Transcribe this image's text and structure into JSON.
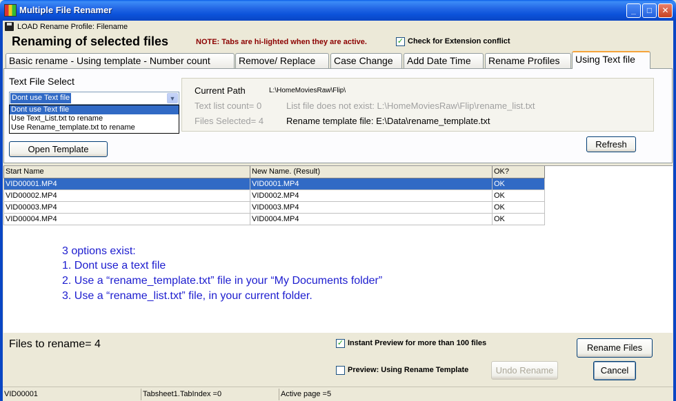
{
  "window": {
    "title": "Multiple File Renamer"
  },
  "profile_label": "LOAD Rename Profile: Filename",
  "heading": "Renaming of selected files",
  "note": "NOTE: Tabs are hi-lighted when they are active.",
  "check_ext_label": "Check for Extension conflict",
  "tabs": [
    {
      "label": "Basic rename - Using template - Number count"
    },
    {
      "label": "Remove/ Replace"
    },
    {
      "label": "Case Change"
    },
    {
      "label": "Add Date Time"
    },
    {
      "label": "Rename Profiles"
    },
    {
      "label": "Using Text file"
    }
  ],
  "text_file_select": {
    "label": "Text File Select",
    "selected": "Dont use Text file",
    "options": [
      "Dont use Text file",
      "Use Text_List.txt to rename",
      "Use Rename_template.txt to rename"
    ]
  },
  "info": {
    "current_path_label": "Current Path",
    "current_path_value": "L:\\HomeMoviesRaw\\Flip\\",
    "text_list_count": "Text list count= 0",
    "list_file_status": "List file does not exist: L:\\HomeMoviesRaw\\Flip\\rename_list.txt",
    "files_selected": "Files Selected= 4",
    "rename_template_file": "Rename template file: E:\\Data\\rename_template.txt"
  },
  "buttons": {
    "open_template": "Open Template",
    "refresh": "Refresh",
    "rename_files": "Rename Files",
    "undo_rename": "Undo Rename",
    "cancel": "Cancel"
  },
  "grid": {
    "headers": [
      "Start Name",
      "New Name. (Result)",
      "OK?"
    ],
    "rows": [
      [
        "VID00001.MP4",
        "VID0001.MP4",
        "OK"
      ],
      [
        "VID00002.MP4",
        "VID0002.MP4",
        "OK"
      ],
      [
        "VID00003.MP4",
        "VID0003.MP4",
        "OK"
      ],
      [
        "VID00004.MP4",
        "VID0004.MP4",
        "OK"
      ]
    ]
  },
  "notes": [
    "3 options exist:",
    "1. Dont use a text file",
    "2. Use a “rename_template.txt” file in your “My Documents folder”",
    "3. Use a “rename_list.txt” file, in your current folder."
  ],
  "files_to_rename": "Files to rename= 4",
  "instant_preview_label": "Instant Preview for more than 100 files",
  "preview_template_label": "Preview: Using Rename Template",
  "status": {
    "cell1": "VID00001",
    "cell2": "Tabsheet1.TabIndex =0",
    "cell3": "Active page =5"
  }
}
